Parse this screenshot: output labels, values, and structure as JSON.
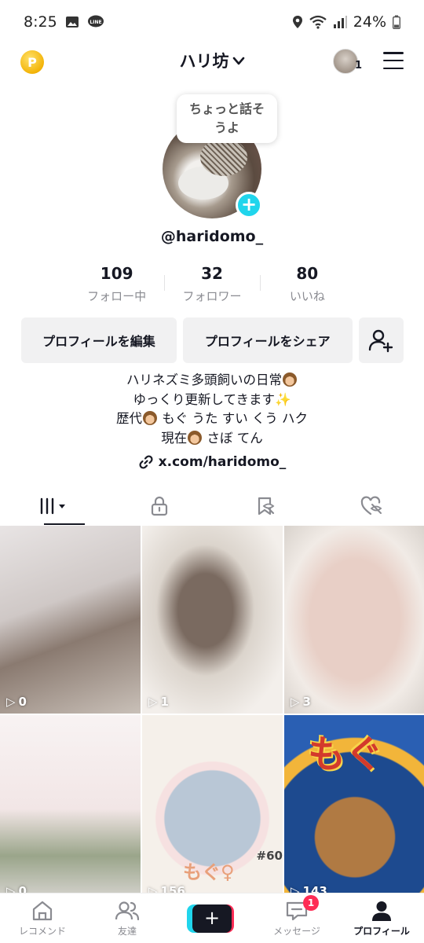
{
  "status_bar": {
    "time": "8:25",
    "battery": "24%"
  },
  "header": {
    "title": "ハリ坊",
    "account_count": "1"
  },
  "profile": {
    "bubble_text_1": "ちょっと話そ",
    "bubble_text_2": "うよ",
    "handle": "@haridomo_",
    "stats": [
      {
        "value": "109",
        "label": "フォロー中"
      },
      {
        "value": "32",
        "label": "フォロワー"
      },
      {
        "value": "80",
        "label": "いいね"
      }
    ],
    "edit_button": "プロフィールを編集",
    "share_button": "プロフィールをシェア",
    "bio": {
      "line1": "ハリネズミ多頭飼いの日常",
      "line2": "ゆっくり更新してきます",
      "line3": "歴代",
      "line3b": " もぐ うた すい くう ハク",
      "line4": "現在",
      "line4b": " さぼ てん"
    },
    "link": "x.com/haridomo_"
  },
  "videos": [
    {
      "views": "0"
    },
    {
      "views": "1"
    },
    {
      "views": "3"
    },
    {
      "views": "0"
    },
    {
      "views": "156",
      "overlay_text": "もぐ♀",
      "overlay_num": "#60"
    },
    {
      "views": "143",
      "overlay_text": "もぐ"
    }
  ],
  "bottom_nav": {
    "home": "レコメンド",
    "friends": "友達",
    "inbox": "メッセージ",
    "inbox_badge": "1",
    "profile": "プロフィール"
  },
  "colors": {
    "accent_pink": "#fe2c55",
    "accent_cyan": "#20d5ec",
    "coin": "#f3b409"
  }
}
